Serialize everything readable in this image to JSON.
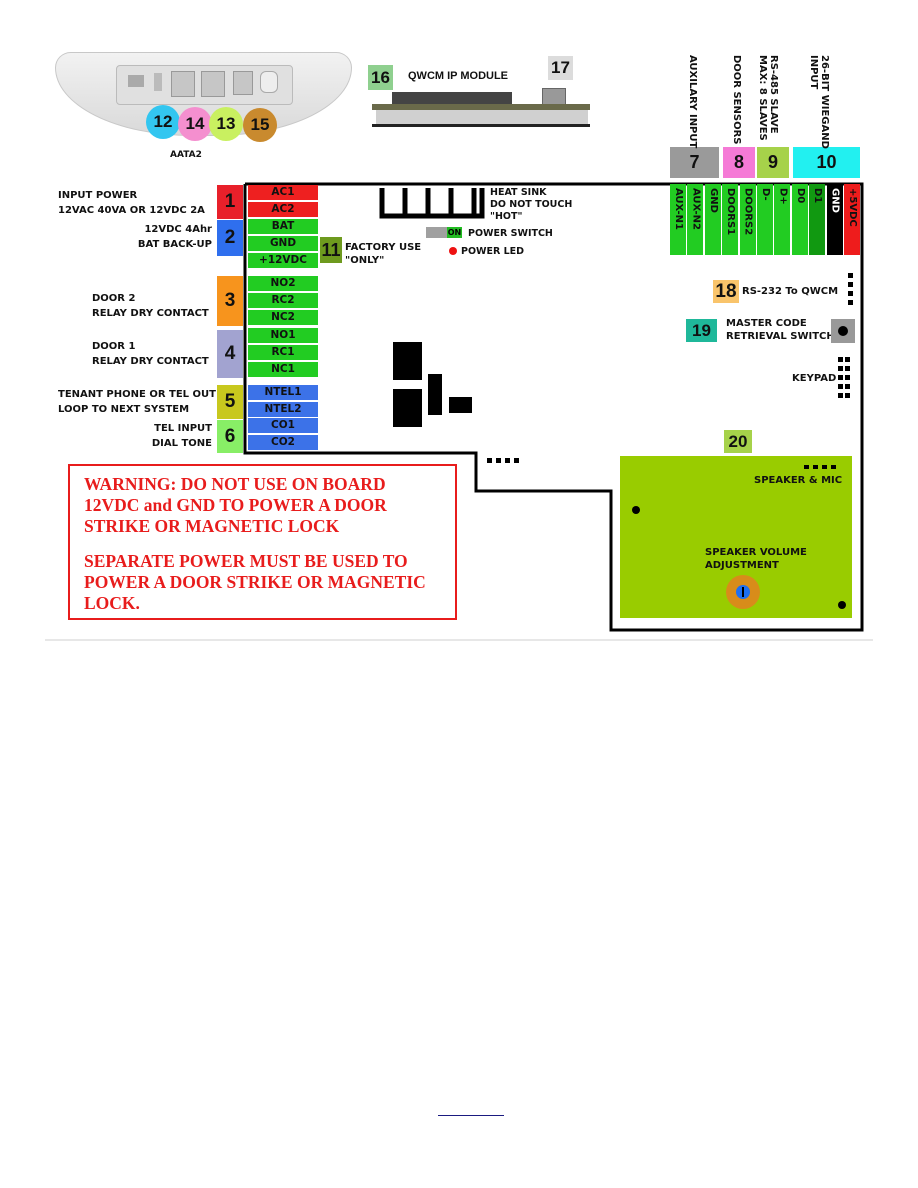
{
  "aata": {
    "label": "AATA2",
    "ports": [
      {
        "num": "12",
        "color": "#33c6f0"
      },
      {
        "num": "14",
        "color": "#f48fcf"
      },
      {
        "num": "13",
        "color": "#c9f060"
      },
      {
        "num": "15",
        "color": "#c98a2e"
      }
    ]
  },
  "qwcm": {
    "num16": "16",
    "title": "QWCM IP MODULE",
    "num17": "17"
  },
  "left_groups": [
    {
      "num": "1",
      "color": "#e8202a",
      "lines": [
        "INPUT POWER",
        "12VAC 40VA OR 12VDC 2A"
      ]
    },
    {
      "num": "2",
      "color": "#2f6fee",
      "lines": [
        "12VDC 4Ahr",
        "BAT BACK-UP"
      ]
    },
    {
      "num": "3",
      "color": "#f7941d",
      "lines": [
        "DOOR 2",
        "RELAY DRY CONTACT"
      ]
    },
    {
      "num": "4",
      "color": "#a2a3d0",
      "lines": [
        "DOOR 1",
        "RELAY DRY CONTACT"
      ]
    },
    {
      "num": "5",
      "color": "#c8c81e",
      "lines": [
        "TENANT PHONE OR TEL OUT",
        "LOOP TO NEXT SYSTEM"
      ]
    },
    {
      "num": "6",
      "color": "#88ee66",
      "lines": [
        "TEL INPUT",
        "DIAL TONE"
      ]
    }
  ],
  "left_terminals": [
    {
      "label": "AC1",
      "color": "#ee2020"
    },
    {
      "label": "AC2",
      "color": "#ee2020"
    },
    {
      "label": "BAT",
      "color": "#22cc22"
    },
    {
      "label": "GND",
      "color": "#22cc22"
    },
    {
      "label": "+12VDC",
      "color": "#22cc22"
    },
    {
      "label": "NO2",
      "color": "#22cc22"
    },
    {
      "label": "RC2",
      "color": "#22cc22"
    },
    {
      "label": "NC2",
      "color": "#22cc22"
    },
    {
      "label": "NO1",
      "color": "#22cc22"
    },
    {
      "label": "RC1",
      "color": "#22cc22"
    },
    {
      "label": "NC1",
      "color": "#22cc22"
    },
    {
      "label": "NTEL1",
      "color": "#3c72e8"
    },
    {
      "label": "NTEL2",
      "color": "#3c72e8"
    },
    {
      "label": "CO1",
      "color": "#3c72e8"
    },
    {
      "label": "CO2",
      "color": "#3c72e8"
    }
  ],
  "factory": {
    "num": "11",
    "lines": [
      "FACTORY USE",
      "\"ONLY\""
    ]
  },
  "heatsink": {
    "lines": [
      "HEAT SINK",
      "DO NOT TOUCH",
      "\"HOT\""
    ]
  },
  "power_switch": {
    "state": "ON",
    "label": "POWER SWITCH"
  },
  "power_led": {
    "label": "POWER LED"
  },
  "top_groups": [
    {
      "num": "7",
      "color": "#9a9a9a",
      "lines": [
        "AUXILARY INPUT"
      ]
    },
    {
      "num": "8",
      "color": "#f57ad6",
      "lines": [
        "DOOR SENSORS"
      ]
    },
    {
      "num": "9",
      "color": "#a6d24a",
      "lines": [
        "RS-485 SLAVE",
        "MAX: 8 SLAVES"
      ]
    },
    {
      "num": "10",
      "color": "#22f0f0",
      "lines": [
        "26-BIT WIEGAND",
        "INPUT"
      ]
    }
  ],
  "top_terminals": [
    {
      "label": "AUX-N1",
      "color": "#22cc22"
    },
    {
      "label": "AUX-N2",
      "color": "#22cc22"
    },
    {
      "label": "GND",
      "color": "#22cc22"
    },
    {
      "label": "DOORS1",
      "color": "#22cc22"
    },
    {
      "label": "DOORS2",
      "color": "#22cc22"
    },
    {
      "label": "D-",
      "color": "#22cc22"
    },
    {
      "label": "D+",
      "color": "#22cc22"
    },
    {
      "label": "D0",
      "color": "#22cc22"
    },
    {
      "label": "D1",
      "color": "#119911"
    },
    {
      "label": "GND",
      "color": "#000000",
      "text": "#ffffff"
    },
    {
      "label": "+5VDC",
      "color": "#ee1c1c"
    }
  ],
  "rs232": {
    "num": "18",
    "label": "RS-232 To QWCM"
  },
  "master": {
    "num": "19",
    "lines": [
      "MASTER CODE",
      "RETRIEVAL SWITCH"
    ]
  },
  "keypad": {
    "label": "KEYPAD"
  },
  "speaker": {
    "num": "20",
    "mic_label": "SPEAKER & MIC",
    "volume_lines": [
      "SPEAKER VOLUME",
      "ADJUSTMENT"
    ]
  },
  "warning": {
    "p1": [
      "WARNING: DO NOT USE ON BOARD",
      "12VDC and GND TO POWER A DOOR",
      "STRIKE OR MAGNETIC LOCK"
    ],
    "p2": [
      "SEPARATE POWER MUST BE USED TO",
      "POWER A DOOR STRIKE OR MAGNETIC",
      "LOCK."
    ]
  }
}
